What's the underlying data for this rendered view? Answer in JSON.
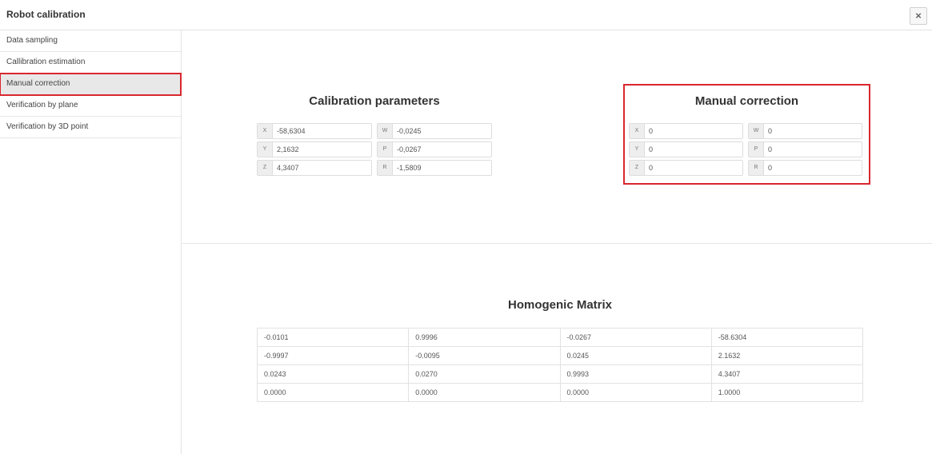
{
  "window": {
    "title": "Robot calibration",
    "close_glyph": "×"
  },
  "sidebar": {
    "items": [
      {
        "label": "Data sampling"
      },
      {
        "label": "Callibration estimation"
      },
      {
        "label": "Manual correction"
      },
      {
        "label": "Verification by plane"
      },
      {
        "label": "Verification by 3D point"
      }
    ]
  },
  "calibration": {
    "title": "Calibration parameters",
    "x_label": "X",
    "x_value": "-58,6304",
    "y_label": "Y",
    "y_value": "2,1632",
    "z_label": "Z",
    "z_value": "4,3407",
    "w_label": "W",
    "w_value": "-0,0245",
    "p_label": "P",
    "p_value": "-0,0267",
    "r_label": "R",
    "r_value": "-1,5809"
  },
  "manual": {
    "title": "Manual correction",
    "x_label": "X",
    "x_value": "0",
    "y_label": "Y",
    "y_value": "0",
    "z_label": "Z",
    "z_value": "0",
    "w_label": "W",
    "w_value": "0",
    "p_label": "P",
    "p_value": "0",
    "r_label": "R",
    "r_value": "0"
  },
  "matrix": {
    "title": "Homogenic Matrix",
    "rows": [
      [
        "-0.0101",
        "0.9996",
        "-0.0267",
        "-58.6304"
      ],
      [
        "-0.9997",
        "-0.0095",
        "0.0245",
        "2.1632"
      ],
      [
        "0.0243",
        "0.0270",
        "0.9993",
        "4.3407"
      ],
      [
        "0.0000",
        "0.0000",
        "0.0000",
        "1.0000"
      ]
    ]
  },
  "colors": {
    "highlight": "#d9272e",
    "active_item": "#e8e8e8"
  }
}
